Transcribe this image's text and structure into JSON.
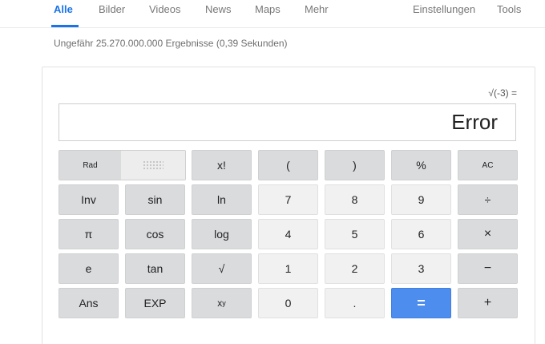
{
  "nav": {
    "tabs": [
      {
        "label": "Alle",
        "active": true
      },
      {
        "label": "Bilder"
      },
      {
        "label": "Videos"
      },
      {
        "label": "News"
      },
      {
        "label": "Maps"
      },
      {
        "label": "Mehr"
      }
    ],
    "settings_label": "Einstellungen",
    "tools_label": "Tools",
    "accent_color": "#1a73e8"
  },
  "results_stats": "Ungefähr 25.270.000.000 Ergebnisse (0,39 Sekunden)",
  "calculator": {
    "expression": "√(-3) =",
    "display": "Error",
    "angle_mode": {
      "rad": "Rad",
      "deg_icon": "dotted-pattern-icon"
    },
    "buttons": {
      "fact": "x!",
      "lparen": "(",
      "rparen": ")",
      "percent": "%",
      "ac": "AC",
      "inv": "Inv",
      "sin": "sin",
      "ln": "ln",
      "seven": "7",
      "eight": "8",
      "nine": "9",
      "divide": "÷",
      "pi": "π",
      "cos": "cos",
      "log": "log",
      "four": "4",
      "five": "5",
      "six": "6",
      "multiply": "×",
      "e": "e",
      "tan": "tan",
      "sqrt": "√",
      "one": "1",
      "two": "2",
      "three": "3",
      "minus": "−",
      "ans": "Ans",
      "exp": "EXP",
      "pow_base": "x",
      "pow_exp": "y",
      "zero": "0",
      "dot": ".",
      "equals": "=",
      "plus": "+"
    },
    "equals_color": "#4c8dee"
  }
}
